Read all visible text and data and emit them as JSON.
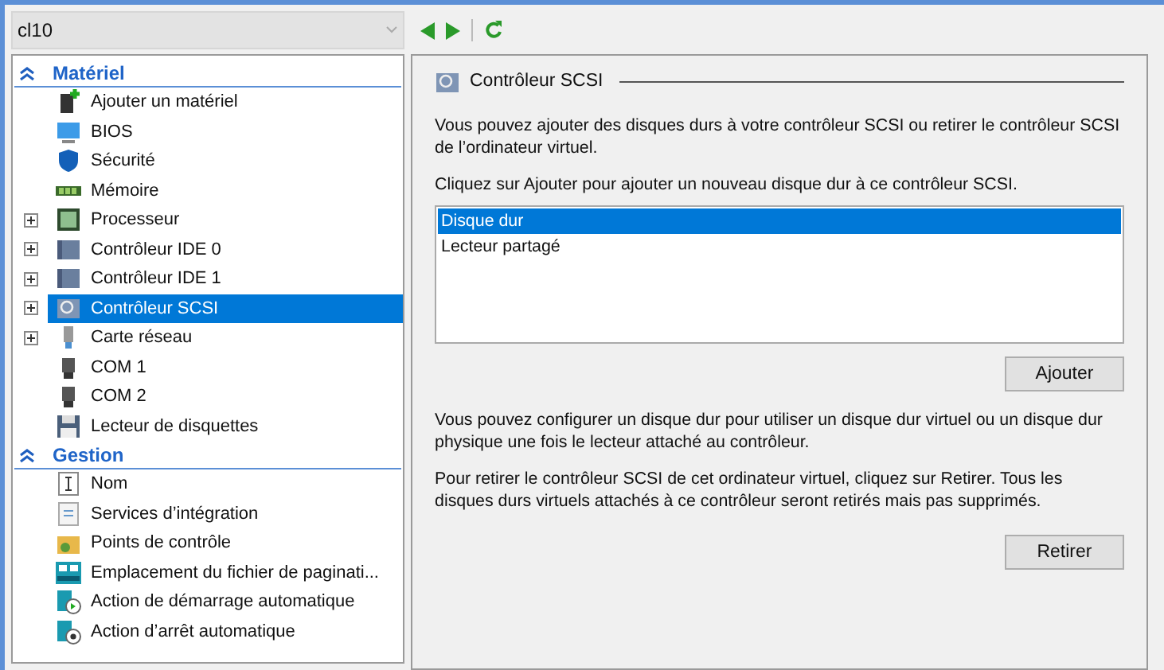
{
  "vm_selector": {
    "value": "cl10"
  },
  "sidebar": {
    "sections": [
      {
        "title": "Matériel",
        "items": [
          {
            "label": "Ajouter un matériel",
            "kind": "add-hardware",
            "expandable": false,
            "selected": false
          },
          {
            "label": "BIOS",
            "kind": "monitor",
            "expandable": false,
            "selected": false
          },
          {
            "label": "Sécurité",
            "kind": "shield",
            "expandable": false,
            "selected": false
          },
          {
            "label": "Mémoire",
            "kind": "memory",
            "expandable": false,
            "selected": false
          },
          {
            "label": "Processeur",
            "kind": "chip",
            "expandable": true,
            "selected": false
          },
          {
            "label": "Contrôleur IDE 0",
            "kind": "controller",
            "expandable": true,
            "selected": false
          },
          {
            "label": "Contrôleur IDE 1",
            "kind": "controller",
            "expandable": true,
            "selected": false
          },
          {
            "label": "Contrôleur SCSI",
            "kind": "scsi",
            "expandable": true,
            "selected": true
          },
          {
            "label": "Carte réseau",
            "kind": "network",
            "expandable": true,
            "selected": false
          },
          {
            "label": "COM 1",
            "kind": "port",
            "expandable": false,
            "selected": false
          },
          {
            "label": "COM 2",
            "kind": "port",
            "expandable": false,
            "selected": false
          },
          {
            "label": "Lecteur de disquettes",
            "kind": "floppy",
            "expandable": false,
            "selected": false
          }
        ]
      },
      {
        "title": "Gestion",
        "items": [
          {
            "label": "Nom",
            "kind": "name",
            "expandable": false,
            "selected": false
          },
          {
            "label": "Services d’intégration",
            "kind": "document",
            "expandable": false,
            "selected": false
          },
          {
            "label": "Points de contrôle",
            "kind": "checkpoint",
            "expandable": false,
            "selected": false
          },
          {
            "label": "Emplacement du fichier de paginati...",
            "kind": "paging",
            "expandable": false,
            "selected": false
          },
          {
            "label": "Action de démarrage automatique",
            "kind": "start",
            "expandable": false,
            "selected": false
          },
          {
            "label": "Action d’arrêt automatique",
            "kind": "stop",
            "expandable": false,
            "selected": false
          }
        ]
      }
    ]
  },
  "panel": {
    "title": "Contrôleur SCSI",
    "intro": "Vous pouvez ajouter des disques durs à votre contrôleur SCSI ou retirer le contrôleur SCSI de l’ordinateur virtuel.",
    "instruction": "Cliquez sur Ajouter pour ajouter un nouveau disque dur à ce contrôleur SCSI.",
    "drive_list": [
      {
        "label": "Disque dur",
        "selected": true
      },
      {
        "label": "Lecteur partagé",
        "selected": false
      }
    ],
    "add_button": "Ajouter",
    "configure_text": "Vous pouvez configurer un disque dur pour utiliser un disque dur virtuel ou un disque dur physique une fois le lecteur attaché au contrôleur.",
    "remove_text": "Pour retirer le contrôleur SCSI de cet ordinateur virtuel, cliquez sur Retirer. Tous les disques durs virtuels attachés à ce contrôleur seront retirés mais pas supprimés.",
    "remove_button": "Retirer"
  }
}
